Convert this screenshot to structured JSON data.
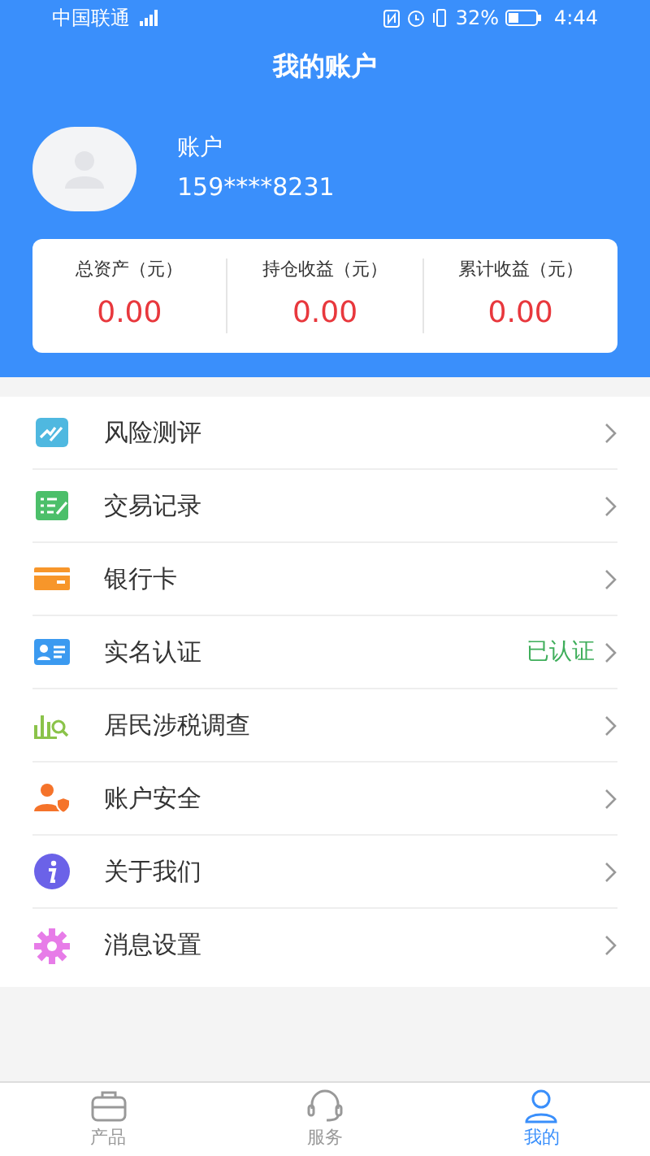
{
  "status_bar": {
    "carrier": "中国联通",
    "battery": "32%",
    "time": "4:44"
  },
  "header": {
    "title": "我的账户"
  },
  "profile": {
    "name": "账户",
    "phone": "159****8231"
  },
  "summary": [
    {
      "label": "总资产（元）",
      "value": "0.00"
    },
    {
      "label": "持仓收益（元）",
      "value": "0.00"
    },
    {
      "label": "累计收益（元）",
      "value": "0.00"
    }
  ],
  "menu": [
    {
      "label": "风险测评"
    },
    {
      "label": "交易记录"
    },
    {
      "label": "银行卡"
    },
    {
      "label": "实名认证",
      "status": "已认证"
    },
    {
      "label": "居民涉税调查"
    },
    {
      "label": "账户安全"
    },
    {
      "label": "关于我们"
    },
    {
      "label": "消息设置"
    }
  ],
  "tabs": [
    {
      "label": "产品",
      "selected": false
    },
    {
      "label": "服务",
      "selected": false
    },
    {
      "label": "我的",
      "selected": true
    }
  ]
}
